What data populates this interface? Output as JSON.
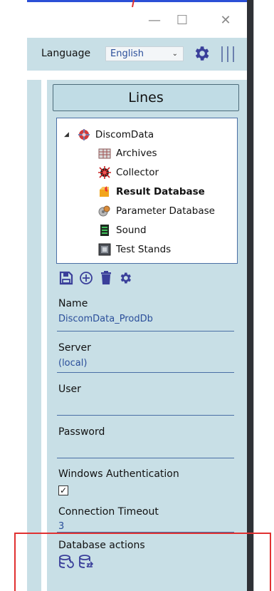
{
  "window": {
    "minimize_glyph": "—",
    "maximize_glyph": "☐",
    "close_glyph": "✕"
  },
  "toolbar": {
    "language_label": "Language",
    "language_value": "English",
    "language_chevron": "⌄",
    "settings_icon": "gear-icon",
    "menu_icon": "vertical-bars-icon"
  },
  "panel": {
    "header": "Lines",
    "tree": {
      "root": {
        "label": "DiscomData",
        "icon": "discom-logo-icon",
        "expander": "◢"
      },
      "items": [
        {
          "label": "Archives",
          "icon": "archives-icon"
        },
        {
          "label": "Collector",
          "icon": "collector-icon"
        },
        {
          "label": "Result Database",
          "icon": "result-database-icon",
          "selected": true
        },
        {
          "label": "Parameter Database",
          "icon": "parameter-database-icon"
        },
        {
          "label": "Sound",
          "icon": "sound-icon"
        },
        {
          "label": "Test Stands",
          "icon": "test-stands-icon"
        }
      ]
    },
    "actions": [
      "save-icon",
      "add-icon",
      "delete-icon",
      "gear-icon"
    ],
    "form": {
      "name_label": "Name",
      "name_value": "DiscomData_ProdDb",
      "server_label": "Server",
      "server_value": "(local)",
      "user_label": "User",
      "user_value": "",
      "password_label": "Password",
      "password_value": "",
      "windows_auth_label": "Windows Authentication",
      "windows_auth_checked": true,
      "windows_auth_checkmark": "✓",
      "timeout_label": "Connection Timeout",
      "timeout_value": "3",
      "db_actions_label": "Database actions",
      "db_action_icons": [
        "database-refresh-icon",
        "database-sync-icon"
      ]
    }
  },
  "colors": {
    "panel_bg": "#c8dfe6",
    "accent_blue": "#2a4e9a",
    "icon_purple": "#3a3f9a",
    "highlight_red": "#e03131",
    "window_edge": "#2f3136"
  }
}
